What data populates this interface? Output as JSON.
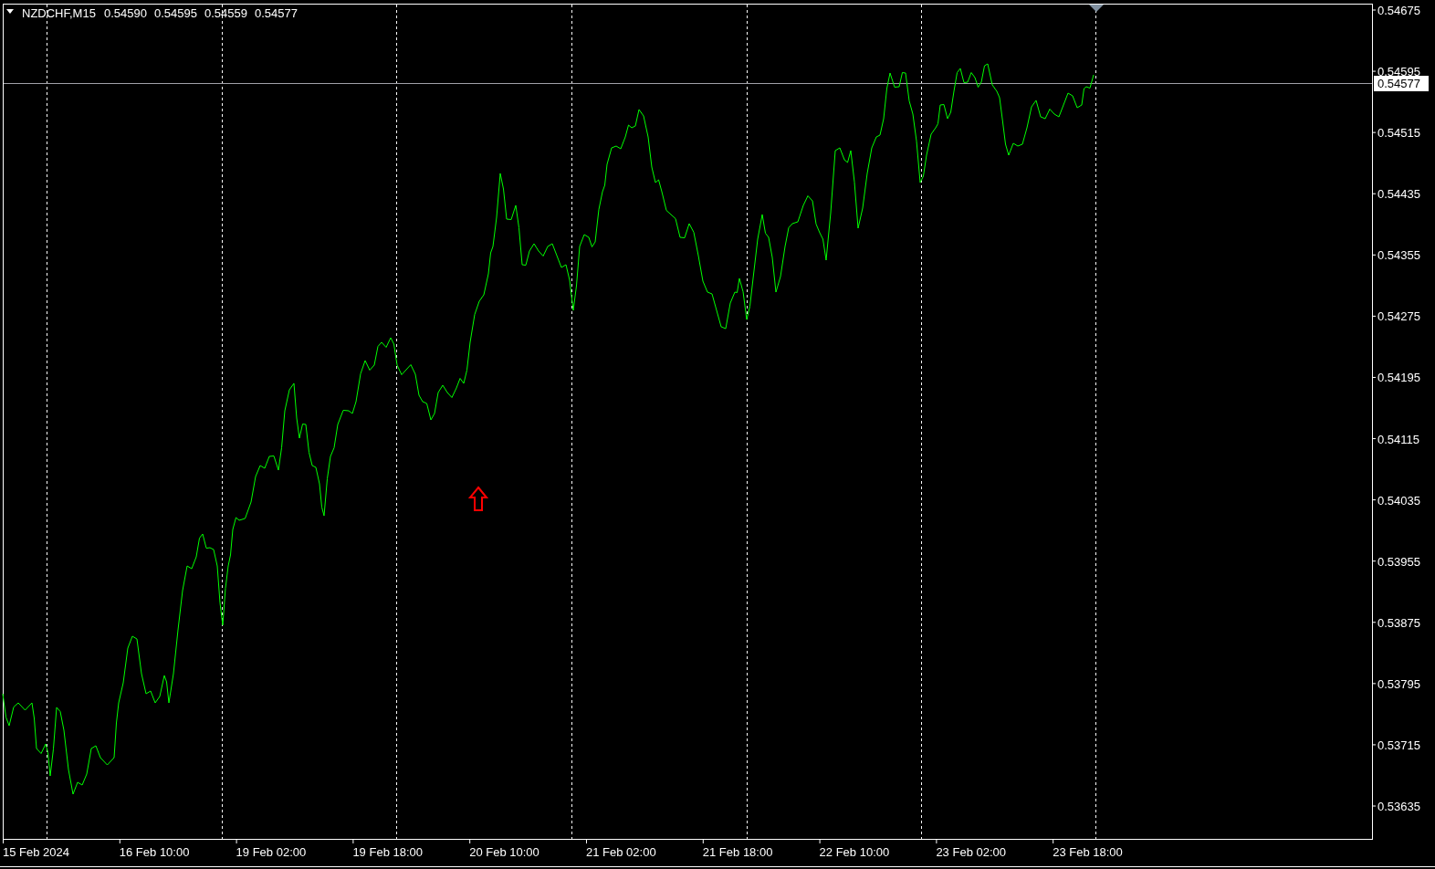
{
  "chart_header": {
    "symbol": "NZDCHF,M15",
    "prices": [
      "0.54590",
      "0.54595",
      "0.54559",
      "0.54577"
    ]
  },
  "price_axis": [
    "0.54675",
    "0.54595",
    "0.54515",
    "0.54435",
    "0.54355",
    "0.54275",
    "0.54195",
    "0.54115",
    "0.54035",
    "0.53955",
    "0.53875",
    "0.53795",
    "0.53715",
    "0.53635"
  ],
  "current_price": "0.54577",
  "time_axis": [
    "15 Feb 2024",
    "16 Feb 10:00",
    "19 Feb 02:00",
    "19 Feb 18:00",
    "20 Feb 10:00",
    "21 Feb 02:00",
    "21 Feb 18:00",
    "22 Feb 10:00",
    "23 Feb 02:00",
    "23 Feb 18:00"
  ]
}
